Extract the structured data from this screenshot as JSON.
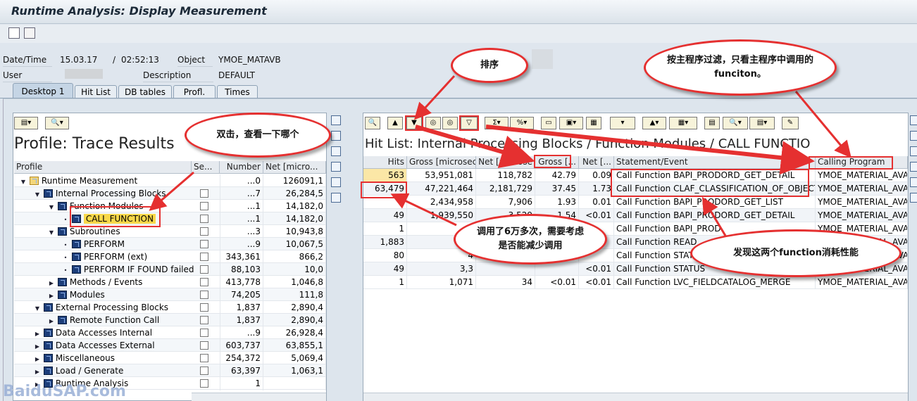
{
  "window": {
    "title": "Runtime Analysis: Display Measurement"
  },
  "header": {
    "date_label": "Date/Time",
    "date": "15.03.17",
    "time_sep": "/",
    "time": "02:52:13",
    "object_label": "Object",
    "object": "YMOE_MATAVB",
    "user_label": "User",
    "description_label": "Description",
    "description": "DEFAULT"
  },
  "tabs": [
    "Desktop 1",
    "Hit List",
    "DB tables",
    "Profl.",
    "Times"
  ],
  "left": {
    "title": "Profile: Trace Results",
    "columns": [
      "Profile",
      "Se...",
      "Number",
      "Net [micro..."
    ],
    "rows": [
      {
        "label": "Runtime Measurement",
        "level": 0,
        "exp": "▼",
        "icon": "folder",
        "num": "...0",
        "net": "126091,1"
      },
      {
        "label": "Internal Processing Blocks",
        "level": 1,
        "exp": "▼",
        "icon": "block",
        "num": "...7",
        "net": "26,284,5"
      },
      {
        "label": "Function Modules",
        "level": 2,
        "exp": "▼",
        "icon": "block",
        "num": "...1",
        "net": "14,182,0"
      },
      {
        "label": "CALL FUNCTION",
        "level": 3,
        "exp": "•",
        "icon": "block",
        "num": "...1",
        "net": "14,182,0"
      },
      {
        "label": "Subroutines",
        "level": 2,
        "exp": "▼",
        "icon": "block",
        "num": "...3",
        "net": "10,943,8"
      },
      {
        "label": "PERFORM",
        "level": 3,
        "exp": "•",
        "icon": "block",
        "num": "...9",
        "net": "10,067,5"
      },
      {
        "label": "PERFORM (ext)",
        "level": 3,
        "exp": "•",
        "icon": "block",
        "num": "343,361",
        "net": "866,2"
      },
      {
        "label": "PERFORM IF FOUND failed",
        "level": 3,
        "exp": "•",
        "icon": "block",
        "num": "88,103",
        "net": "10,0"
      },
      {
        "label": "Methods / Events",
        "level": 2,
        "exp": "▶",
        "icon": "block",
        "num": "413,778",
        "net": "1,046,8"
      },
      {
        "label": "Modules",
        "level": 2,
        "exp": "▶",
        "icon": "block",
        "num": "74,205",
        "net": "111,8"
      },
      {
        "label": "External Processing Blocks",
        "level": 1,
        "exp": "▼",
        "icon": "block",
        "num": "1,837",
        "net": "2,890,4"
      },
      {
        "label": "Remote Function Call",
        "level": 2,
        "exp": "▶",
        "icon": "block",
        "num": "1,837",
        "net": "2,890,4"
      },
      {
        "label": "Data Accesses Internal",
        "level": 1,
        "exp": "▶",
        "icon": "block",
        "num": "...9",
        "net": "26,928,4"
      },
      {
        "label": "Data Accesses External",
        "level": 1,
        "exp": "▶",
        "icon": "block",
        "num": "603,737",
        "net": "63,855,1"
      },
      {
        "label": "Miscellaneous",
        "level": 1,
        "exp": "▶",
        "icon": "block",
        "num": "254,372",
        "net": "5,069,4"
      },
      {
        "label": "Load / Generate",
        "level": 1,
        "exp": "▶",
        "icon": "block",
        "num": "63,397",
        "net": "1,063,1"
      },
      {
        "label": "Runtime Analysis",
        "level": 1,
        "exp": "▶",
        "icon": "block",
        "num": "1",
        "net": ""
      }
    ]
  },
  "right": {
    "title": "Hit List: Internal Processing Blocks / Function Modules / CALL FUNCTIO",
    "columns": [
      "Hits",
      "Gross [microsec]",
      "Net [microse",
      "Gross [...",
      "Net [...",
      "Statement/Event",
      "Calling Program"
    ],
    "rows": [
      [
        "563",
        "53,951,081",
        "118,782",
        "42.79",
        "0.09",
        "Call Function BAPI_PRODORD_GET_DETAIL",
        "YMOE_MATERIAL_AVA"
      ],
      [
        "63,479",
        "47,221,464",
        "2,181,729",
        "37.45",
        "1.73",
        "Call Function CLAF_CLASSIFICATION_OF_OBJECTS",
        "YMOE_MATERIAL_AVA"
      ],
      [
        "1",
        "2,434,958",
        "7,906",
        "1.93",
        "0.01",
        "Call Function BAPI_PRODORD_GET_LIST",
        "YMOE_MATERIAL_AVA"
      ],
      [
        "49",
        "1,939,550",
        "3,529",
        "1.54",
        "<0.01",
        "Call Function BAPI_PRODORD_GET_DETAIL",
        "YMOE_MATERIAL_AVA"
      ],
      [
        "1",
        "1,",
        "",
        "",
        "",
        "Call Function BAPI_PROD",
        "YMOE_MATERIAL_AVA"
      ],
      [
        "1,883",
        "57",
        "",
        "",
        "",
        "Call Function READ_",
        "YMOE_MATERIAL_AVA"
      ],
      [
        "80",
        "4",
        "",
        "",
        "",
        "Call Function STAT",
        "YMOE_MATERIAL_AVA"
      ],
      [
        "49",
        "3,3",
        "",
        "",
        "<0.01",
        "Call Function STATUS",
        "YMOE_MATERIAL_AVA"
      ],
      [
        "1",
        "1,071",
        "34",
        "<0.01",
        "<0.01",
        "Call Function LVC_FIELDCATALOG_MERGE",
        "YMOE_MATERIAL_AVA"
      ]
    ]
  },
  "callouts": {
    "dbl": "双击，查看一下哪个",
    "sort": "排序",
    "filter": "按主程序过滤，只看主程序中调用的funciton。",
    "calls": "调用了6万多次，需要考虑是否能减少调用",
    "cost": "发现这两个function消耗性能"
  },
  "watermark": "BaiduSAP.com",
  "colors": {
    "highlight": "#e53030",
    "hits_hl": "#fbe7a6",
    "selected": "#f8d84a"
  }
}
